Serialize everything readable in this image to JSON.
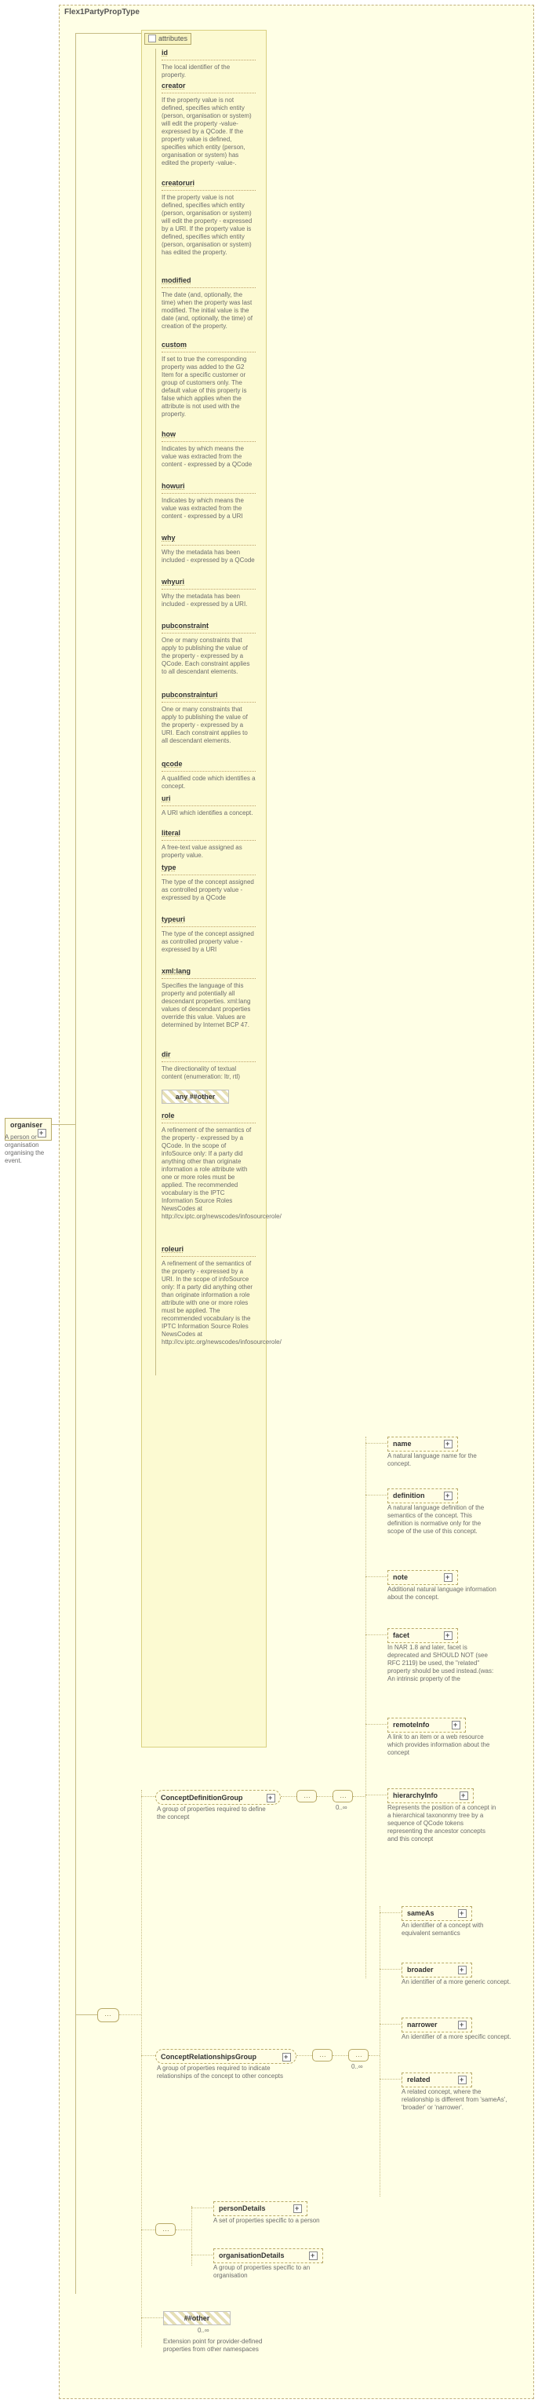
{
  "title": "Flex1PartyPropType",
  "organiser": {
    "name": "organiser",
    "desc": "A person or organisation organising the event."
  },
  "attributes_label": "attributes",
  "any_label": "any ##other",
  "cardinality_0inf": "0..∞",
  "groups": {
    "conceptDefinition": {
      "name": "ConceptDefinitionGroup",
      "desc": "A group of properties required to define the concept"
    },
    "conceptRelationships": {
      "name": "ConceptRelationshipsGroup",
      "desc": "A group of properties required to indicate relationships of the concept to other concepts"
    }
  },
  "rightElems": {
    "name": {
      "label": "name",
      "desc": "A natural language name for the concept."
    },
    "definition": {
      "label": "definition",
      "desc": "A natural language definition of the semantics of the concept. This definition is normative only for the scope of the use of this concept."
    },
    "note": {
      "label": "note",
      "desc": "Additional natural language information about the concept."
    },
    "facet": {
      "label": "facet",
      "desc": "In NAR 1.8 and later, facet is deprecated and SHOULD NOT (see RFC 2119) be used, the \"related\" property should be used instead.(was: An intrinsic property of the"
    },
    "remoteInfo": {
      "label": "remoteInfo",
      "desc": "A link to an item or a web resource which provides information about the concept"
    },
    "hierarchyInfo": {
      "label": "hierarchyInfo",
      "desc": "Represents the position of a concept in a hierarchical taxononmy tree by a sequence of QCode tokens representing the ancestor concepts and this concept"
    },
    "sameAs": {
      "label": "sameAs",
      "desc": "An identifier of a concept with equivalent semantics"
    },
    "broader": {
      "label": "broader",
      "desc": "An identifier of a more generic concept."
    },
    "narrower": {
      "label": "narrower",
      "desc": "An identifier of a more specific concept."
    },
    "related": {
      "label": "related",
      "desc": "A related concept, where the relationship is different from 'sameAs', 'broader' or 'narrower'."
    },
    "personDetails": {
      "label": "personDetails",
      "desc": "A set of properties specific to a person"
    },
    "organisationDetails": {
      "label": "organisationDetails",
      "desc": "A group of properties specific to an organisation"
    },
    "anyOther": {
      "label": "##other",
      "desc": "Extension point for provider-defined properties from other namespaces"
    }
  },
  "attrs": {
    "id": {
      "name": "id",
      "desc": "The local identifier of the property."
    },
    "creator": {
      "name": "creator",
      "desc": "If the property value is not defined, specifies which entity (person, organisation or system) will edit the property -value- expressed by a QCode. If the property value is defined, specifies which entity (person, organisation or system) has edited the property -value-."
    },
    "creatoruri": {
      "name": "creatoruri",
      "desc": "If the property value is not defined, specifies which entity (person, organisation or system) will edit the property - expressed by a URI. If the property value is defined, specifies which entity (person, organisation or system) has edited the property."
    },
    "modified": {
      "name": "modified",
      "desc": "The date (and, optionally, the time) when the property was last modified. The initial value is the date (and, optionally, the time) of creation of the property."
    },
    "custom": {
      "name": "custom",
      "desc": "If set to true the corresponding property was added to the G2 Item for a specific customer or group of customers only. The default value of this property is false which applies when the attribute is not used with the property."
    },
    "how": {
      "name": "how",
      "desc": "Indicates by which means the value was extracted from the content - expressed by a QCode"
    },
    "howuri": {
      "name": "howuri",
      "desc": "Indicates by which means the value was extracted from the content - expressed by a URI"
    },
    "why": {
      "name": "why",
      "desc": "Why the metadata has been included - expressed by a QCode"
    },
    "whyuri": {
      "name": "whyuri",
      "desc": "Why the metadata has been included - expressed by a URI."
    },
    "pubconstraint": {
      "name": "pubconstraint",
      "desc": "One or many constraints that apply to publishing the value of the property - expressed by a QCode. Each constraint applies to all descendant elements."
    },
    "pubconstrainturi": {
      "name": "pubconstrainturi",
      "desc": "One or many constraints that apply to publishing the value of the property - expressed by a URI. Each constraint applies to all descendant elements."
    },
    "qcode": {
      "name": "qcode",
      "desc": "A qualified code which identifies a concept."
    },
    "uri": {
      "name": "uri",
      "desc": "A URI which identifies a concept."
    },
    "literal": {
      "name": "literal",
      "desc": "A free-text value assigned as property value."
    },
    "type": {
      "name": "type",
      "desc": "The type of the concept assigned as controlled property value - expressed by a QCode"
    },
    "typeuri": {
      "name": "typeuri",
      "desc": "The type of the concept assigned as controlled property value - expressed by a URI"
    },
    "xml_lang": {
      "name": "xml:lang",
      "desc": "Specifies the language of this property and potentially all descendant properties. xml:lang values of descendant properties override this value. Values are determined by Internet BCP 47."
    },
    "dir": {
      "name": "dir",
      "desc": "The directionality of textual content (enumeration: ltr, rtl)"
    },
    "role": {
      "name": "role",
      "desc": "A refinement of the semantics of the property - expressed by a QCode. In the scope of infoSource only: If a party did anything other than originate information a role attribute with one or more roles must be applied. The recommended vocabulary is the IPTC Information Source Roles NewsCodes at http://cv.iptc.org/newscodes/infosourcerole/"
    },
    "roleuri": {
      "name": "roleuri",
      "desc": "A refinement of the semantics of the property - expressed by a URI. In the scope of infoSource only: If a party did anything other than originate information a role attribute with one or more roles must be applied. The recommended vocabulary is the IPTC Information Source Roles NewsCodes at http://cv.iptc.org/newscodes/infosourcerole/"
    }
  }
}
